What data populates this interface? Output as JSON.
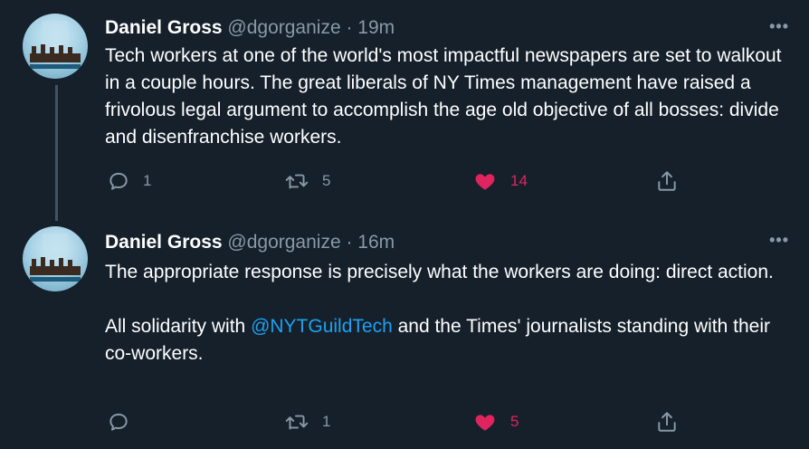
{
  "tweets": [
    {
      "display_name": "Daniel Gross",
      "handle": "@dgorganize",
      "time": "· 19m",
      "more": "•••",
      "text_paragraphs": [
        "Tech workers at one of the world's most impactful newspapers are set to walkout in a couple hours. The great liberals of NY Times management have raised a frivolous legal argument to accomplish the age old objective of all bosses: divide and disenfranchise workers."
      ],
      "replies": "1",
      "retweets": "5",
      "likes": "14",
      "liked": true
    },
    {
      "display_name": "Daniel Gross",
      "handle": "@dgorganize",
      "time": "· 16m",
      "more": "•••",
      "text_p1": "The appropriate response is precisely what the workers are doing: direct action.",
      "text_p2_pre": "All solidarity with ",
      "text_p2_mention": "@NYTGuildTech",
      "text_p2_post": " and the Times' journalists standing with their co-workers.",
      "replies": "",
      "retweets": "1",
      "likes": "5",
      "liked": true
    }
  ],
  "icons": {
    "reply": "speech-bubble-icon",
    "retweet": "retweet-arrows-icon",
    "like": "heart-icon",
    "share": "share-upload-icon",
    "more": "more-dots-icon"
  },
  "colors": {
    "background": "#15202b",
    "text": "#ffffff",
    "muted": "#8899a6",
    "link": "#1da1f2",
    "like": "#e0245e",
    "thread_line": "#3d5466"
  }
}
